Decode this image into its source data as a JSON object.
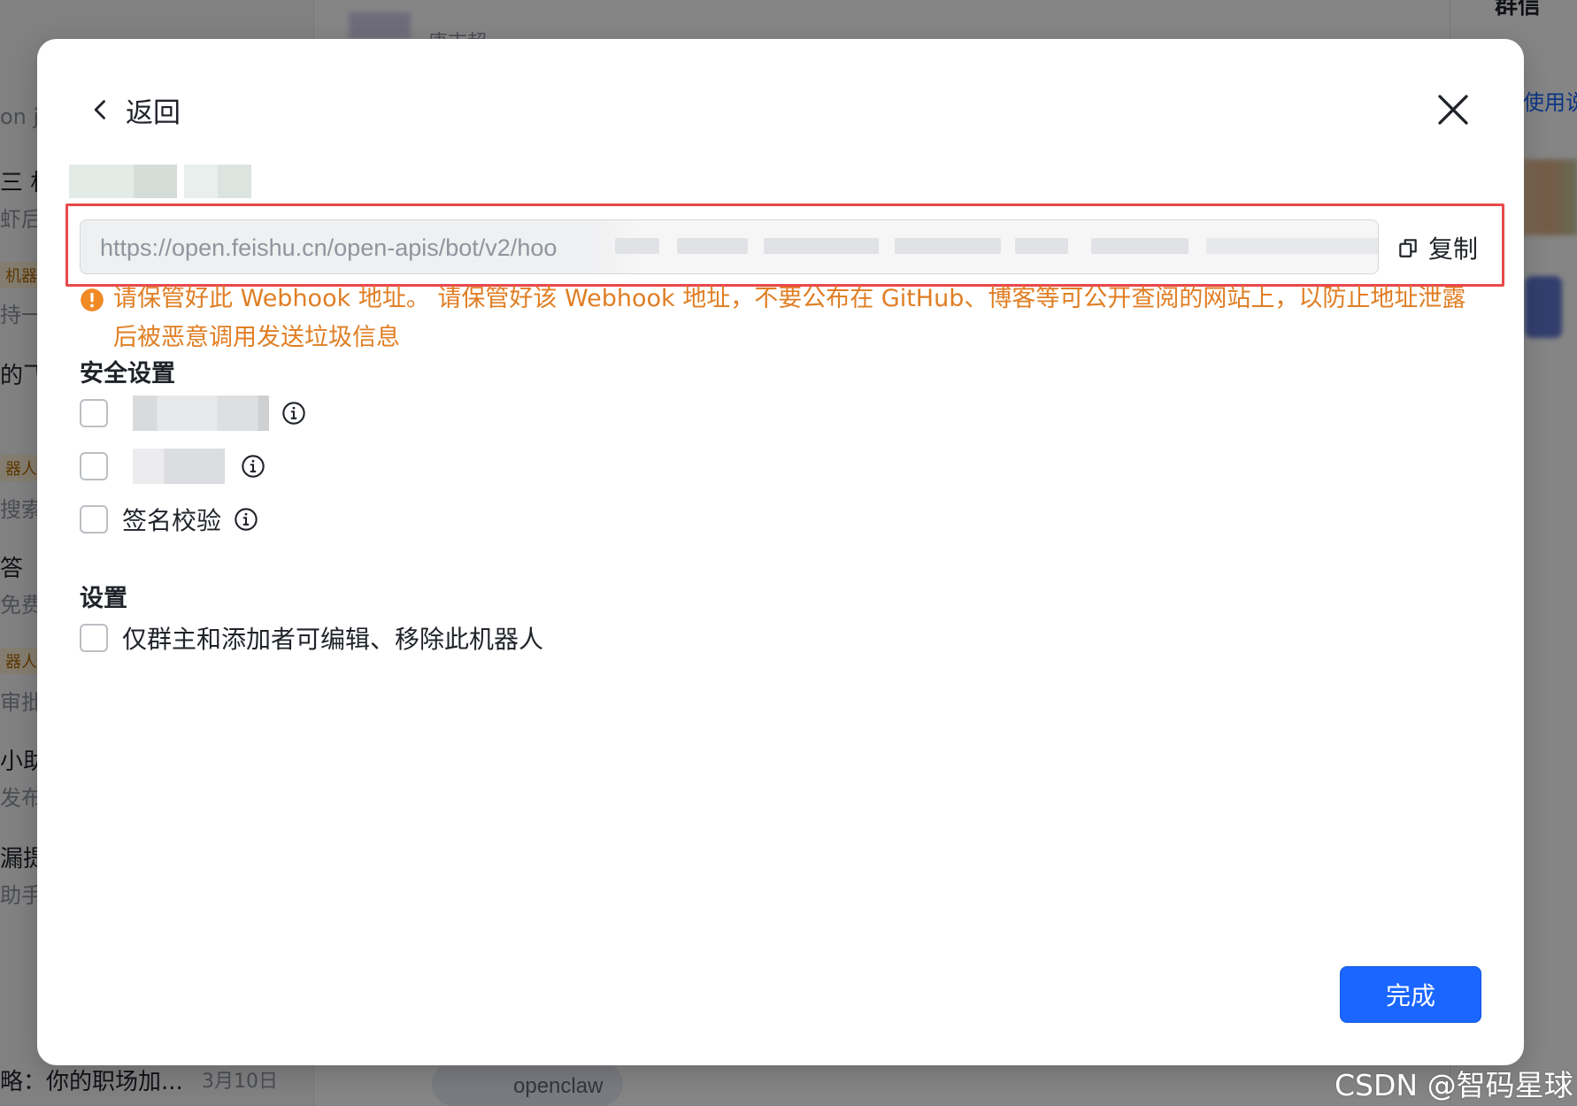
{
  "background": {
    "left_list": [
      {
        "text": "on jo",
        "kind": "sub"
      },
      {
        "text": "三  机",
        "kind": "main"
      },
      {
        "text": "虾后",
        "kind": "sub"
      },
      {
        "text": "机器",
        "kind": "tag"
      },
      {
        "text": "持一",
        "kind": "sub"
      },
      {
        "text": "的飞",
        "kind": "main"
      },
      {
        "text": "器人",
        "kind": "tag"
      },
      {
        "text": "搜索",
        "kind": "sub"
      },
      {
        "text": "答",
        "kind": "main"
      },
      {
        "text": "免费",
        "kind": "sub"
      },
      {
        "text": "器人",
        "kind": "tag"
      },
      {
        "text": "审批",
        "kind": "sub"
      },
      {
        "text": "小助",
        "kind": "main"
      },
      {
        "text": "发布",
        "kind": "sub"
      },
      {
        "text": "漏提",
        "kind": "main"
      },
      {
        "text": "助手",
        "kind": "sub"
      }
    ],
    "bottom_left_text": "略：你的职场加...",
    "bottom_left_date": "3月10日",
    "top_center_text": "唐志超",
    "right_top_text": "群信",
    "right_link_text": "使用说",
    "bottom_chip_text": "openclaw"
  },
  "modal": {
    "back_label": "返回",
    "webhook_url": "https://open.feishu.cn/open-apis/bot/v2/hoo",
    "copy_label": "复制",
    "warning_text": "请保管好此 Webhook 地址。 请保管好该 Webhook 地址，不要公布在 GitHub、博客等可公开查阅的网站上，以防止地址泄露后被恶意调用发送垃圾信息",
    "security_title": "安全设置",
    "security_options": [
      {
        "label": "",
        "checked": false
      },
      {
        "label": "",
        "checked": false
      },
      {
        "label": "签名校验",
        "checked": false
      }
    ],
    "settings_title": "设置",
    "settings_options": [
      {
        "label": "仅群主和添加者可编辑、移除此机器人",
        "checked": false
      }
    ],
    "done_label": "完成"
  },
  "colors": {
    "primary": "#1a66ff",
    "warning": "#e07e24",
    "highlight": "#e8494a"
  },
  "icons": [
    "chevron-left-icon",
    "close-icon",
    "copy-icon",
    "warning-icon",
    "info-icon"
  ],
  "watermark": "CSDN @智码星球"
}
